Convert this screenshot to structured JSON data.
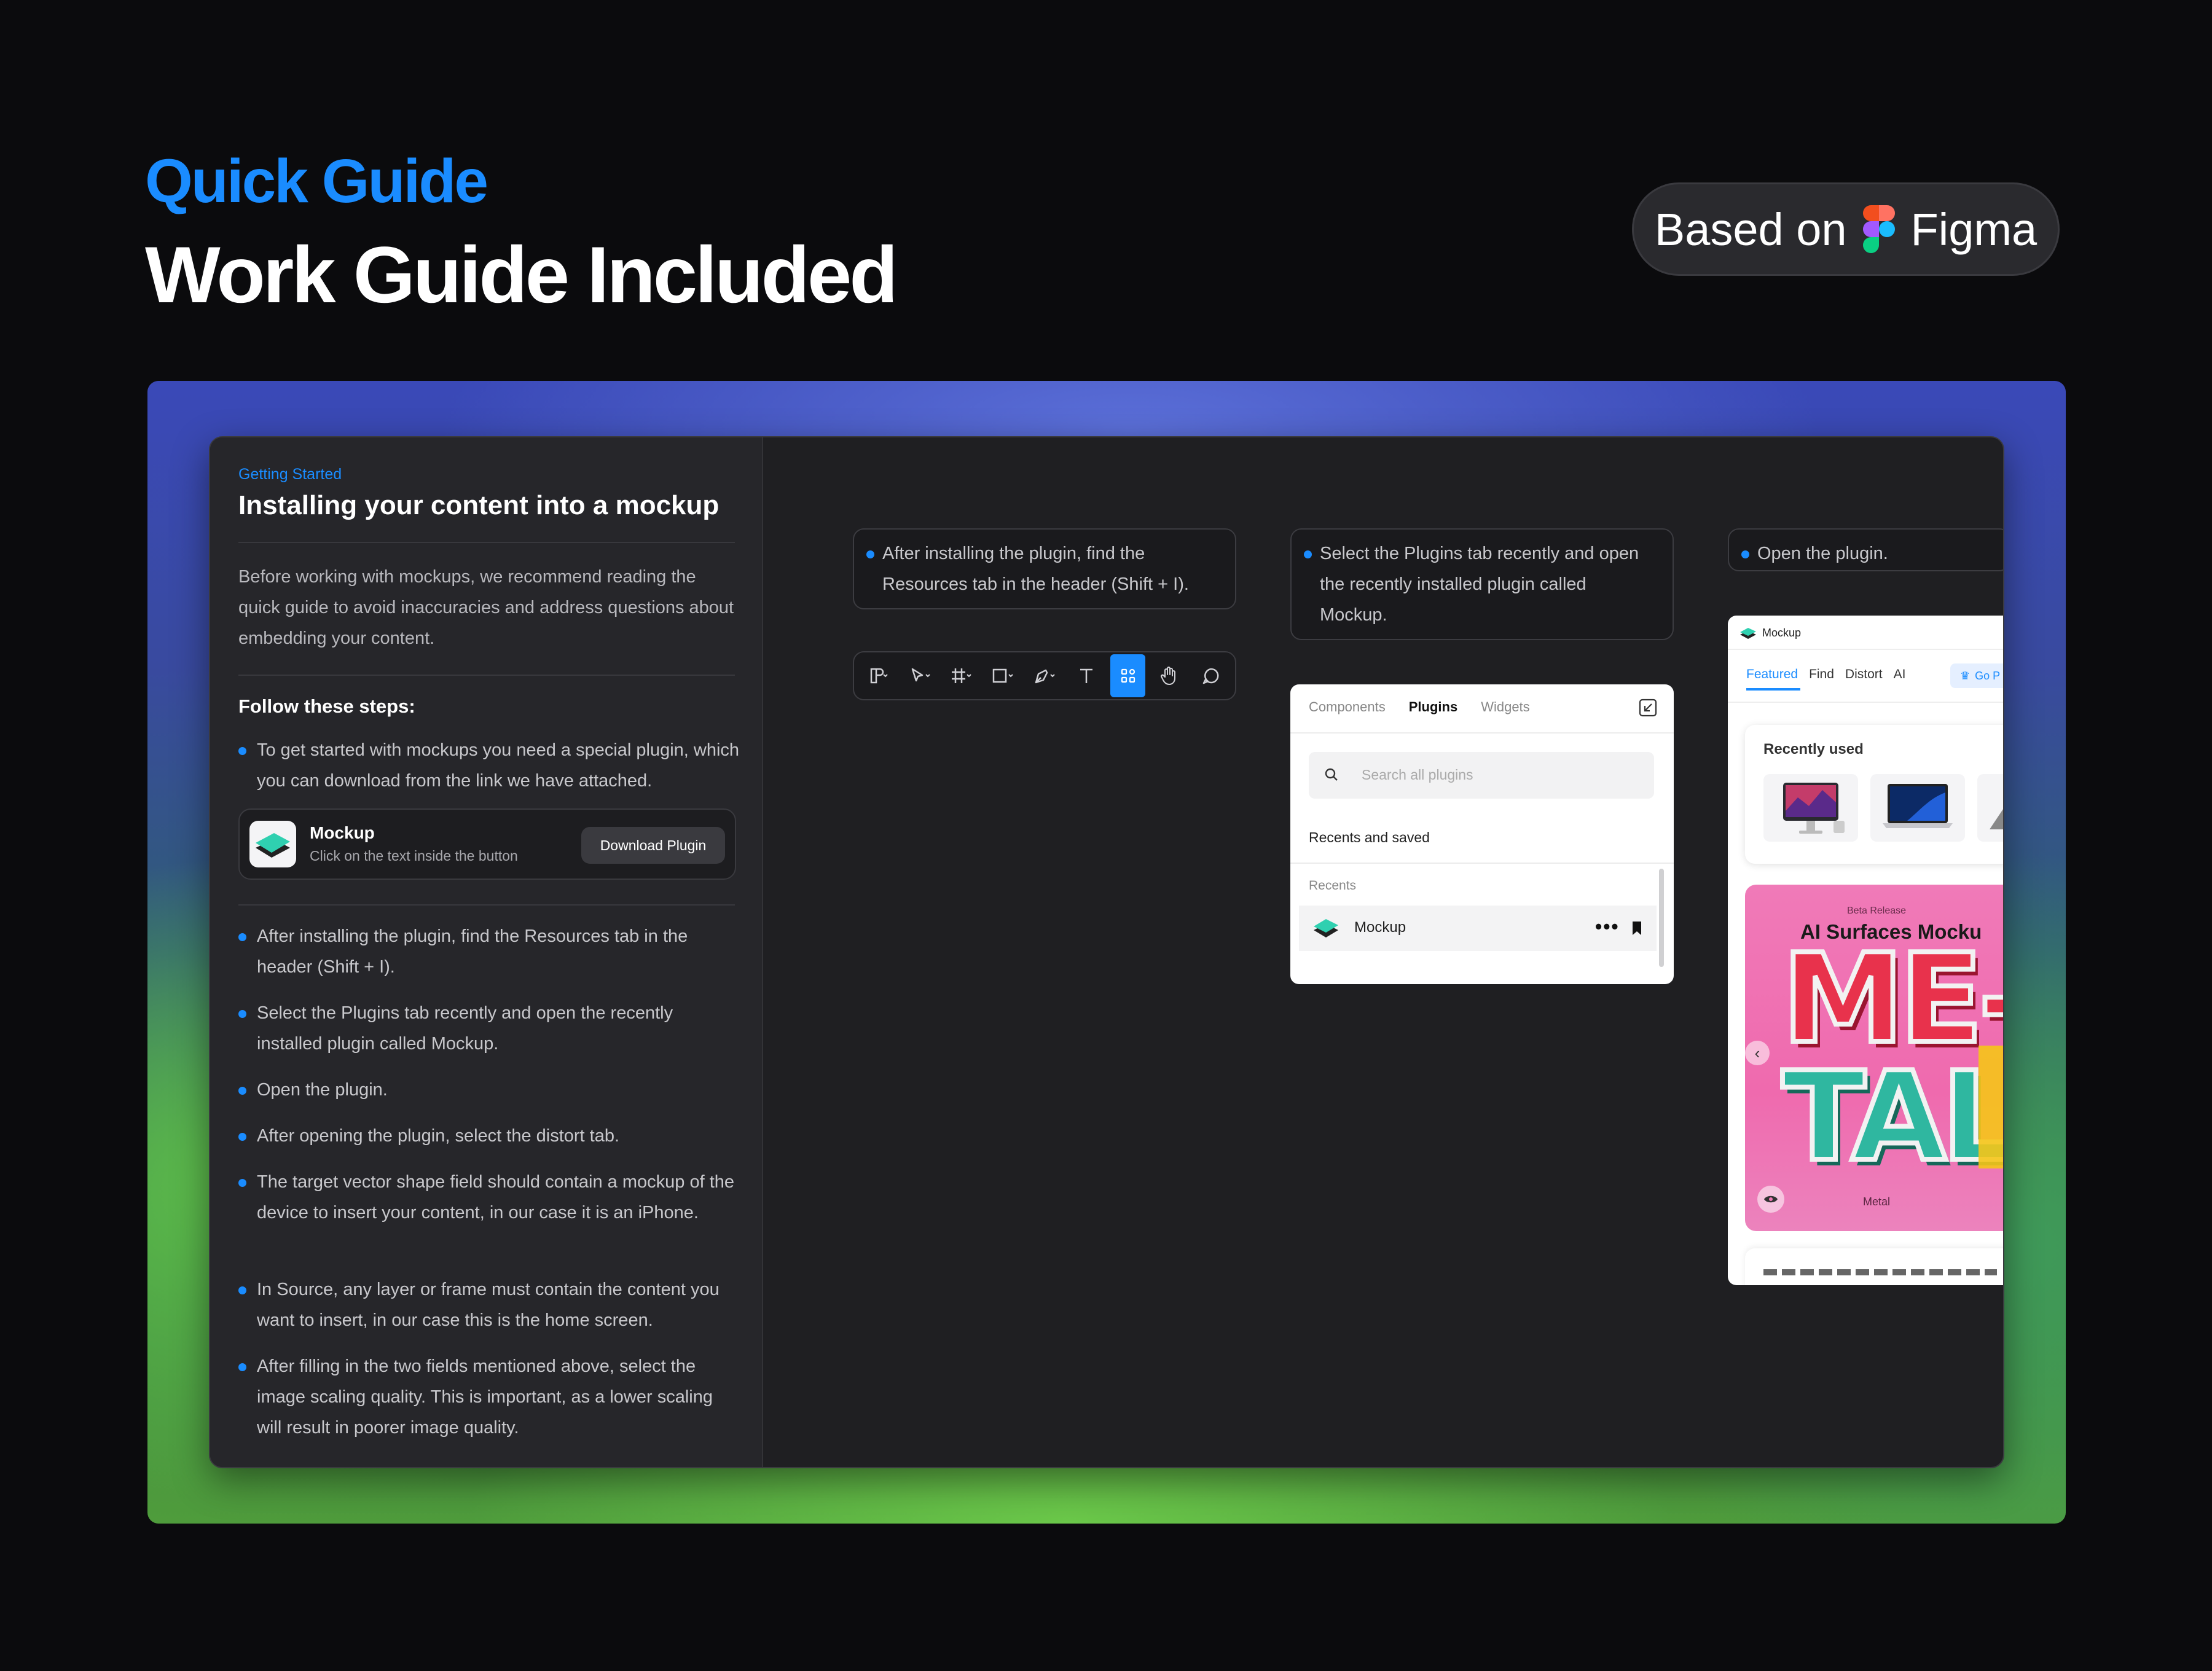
{
  "header": {
    "kicker": "Quick Guide",
    "title": "Work Guide Included",
    "based_on": "Based on",
    "tool_name": "Figma"
  },
  "panel": {
    "eyebrow": "Getting Started",
    "title": "Installing your content into a mockup",
    "intro": "Before working with mockups, we recommend reading the quick guide to avoid inaccuracies and address questions about embedding your content.",
    "steps_heading": "Follow these steps:",
    "first_step": "To get started with mockups you need a special plugin, which you can download from the link we have attached.",
    "plugin_card": {
      "name": "Mockup",
      "hint": "Click on the text inside the button",
      "button": "Download Plugin"
    },
    "steps": [
      "After installing the plugin, find the Resources tab in the header (Shift + I).",
      "Select the Plugins tab recently and open the recently installed plugin called Mockup.",
      "Open the plugin.",
      "After opening the plugin, select the distort tab.",
      "The target vector shape field should contain a mockup of the device to insert your content, in our case it is an iPhone.",
      "In Source, any layer or frame must contain the content you want to insert, in our case this is the home screen.",
      "After filling in the two fields mentioned above, select the image scaling quality. This is important, as a lower scaling will result in poorer image quality."
    ]
  },
  "callouts": {
    "one": "After installing the plugin, find the Resources tab in the header (Shift + I).",
    "two": "Select the Plugins tab recently and open the recently installed plugin called Mockup.",
    "three": "Open the plugin."
  },
  "toolbar": {
    "icons": [
      "figma-menu-icon",
      "move-tool-icon",
      "frame-tool-icon",
      "rectangle-tool-icon",
      "pen-tool-icon",
      "text-tool-icon",
      "resources-icon",
      "hand-tool-icon",
      "comment-icon"
    ],
    "active": "resources-icon"
  },
  "resources_panel": {
    "tabs": [
      "Components",
      "Plugins",
      "Widgets"
    ],
    "active_tab": "Plugins",
    "search_placeholder": "Search all plugins",
    "section": "Recents and saved",
    "subsection": "Recents",
    "item": "Mockup"
  },
  "plugin_window": {
    "title": "Mockup",
    "tabs": [
      "Featured",
      "Find",
      "Distort",
      "AI"
    ],
    "go_pro": "Go P",
    "recently_used": "Recently used",
    "banner_tag": "Beta Release",
    "banner_title": "AI Surfaces Mocku",
    "banner_art_1": "ME-",
    "banner_art_2": "TAL",
    "banner_caption": "Metal"
  },
  "colors": {
    "accent": "#1a8cff",
    "background": "#0b0b0d",
    "panel": "#26262a"
  }
}
